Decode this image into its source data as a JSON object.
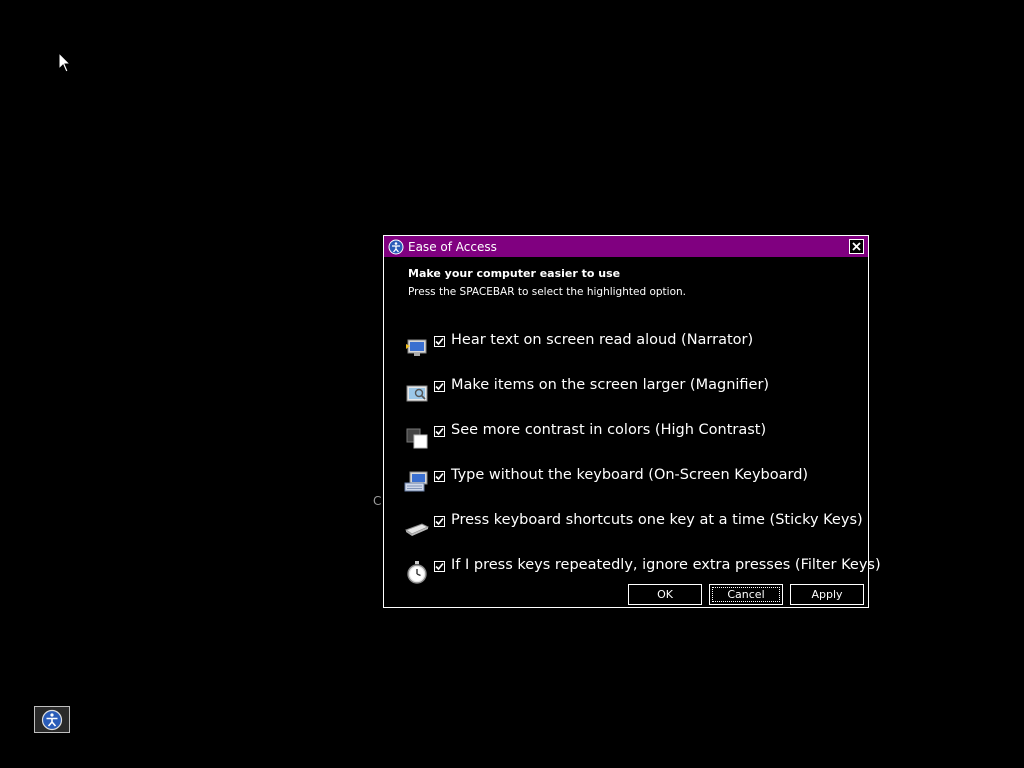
{
  "window": {
    "title": "Ease of Access",
    "accent_color": "#800080"
  },
  "stray_text": "C",
  "content": {
    "heading": "Make your computer easier to use",
    "subheading": "Press the SPACEBAR to select the highlighted option."
  },
  "options": [
    {
      "label": "Hear text on screen read aloud (Narrator)",
      "checked": true,
      "icon": "narrator-icon"
    },
    {
      "label": "Make items on the screen larger (Magnifier)",
      "checked": true,
      "icon": "magnifier-icon"
    },
    {
      "label": "See more contrast in colors (High Contrast)",
      "checked": true,
      "icon": "high-contrast-icon"
    },
    {
      "label": "Type without the keyboard (On-Screen Keyboard)",
      "checked": true,
      "icon": "on-screen-keyboard-icon"
    },
    {
      "label": "Press keyboard shortcuts one key at a time (Sticky Keys)",
      "checked": true,
      "icon": "sticky-keys-icon"
    },
    {
      "label": "If I press keys repeatedly, ignore extra presses (Filter Keys)",
      "checked": true,
      "icon": "filter-keys-icon"
    }
  ],
  "buttons": {
    "ok": "OK",
    "cancel": "Cancel",
    "apply": "Apply"
  }
}
